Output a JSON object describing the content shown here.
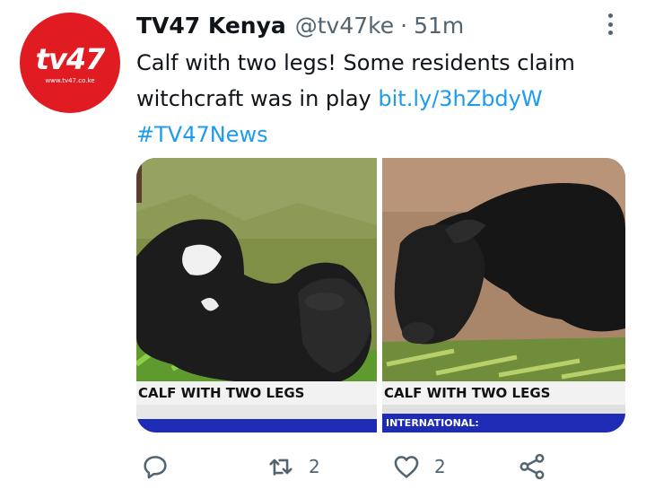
{
  "tweet": {
    "display_name": "TV47 Kenya",
    "handle": "@tv47ke",
    "separator": "·",
    "time": "51m",
    "text_part": "Calf with two legs! Some residents claim witchcraft was in play ",
    "link": "bit.ly/3hZbdyW",
    "hashtag": "#TV47News",
    "avatar": {
      "logo": "tv47",
      "url": "www.tv47.co.ke",
      "color": "#e11b22"
    }
  },
  "media": [
    {
      "caption": "CALF WITH TWO LEGS",
      "ticker": ""
    },
    {
      "caption": "CALF WITH TWO LEGS",
      "ticker": "INTERNATIONAL:"
    }
  ],
  "actions": {
    "reply_count": "",
    "retweet_count": "2",
    "like_count": "2",
    "share_count": ""
  },
  "colors": {
    "link": "#1d9bf0",
    "muted": "#536471",
    "text": "#0f1419"
  }
}
